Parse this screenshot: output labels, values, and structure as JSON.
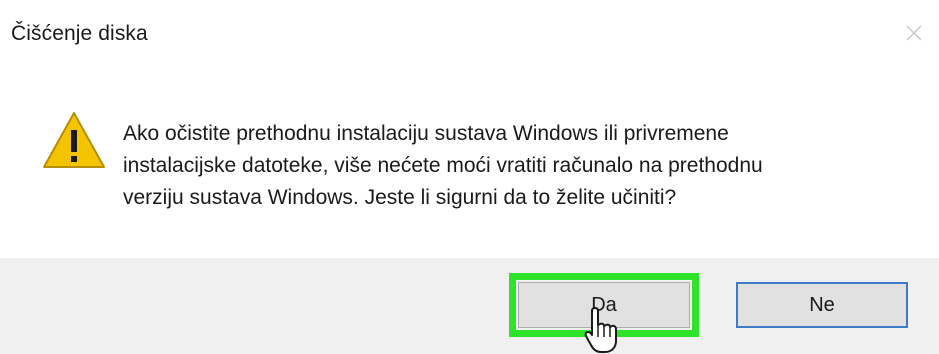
{
  "window": {
    "title": "Čišćenje diska",
    "close_icon": "close-icon"
  },
  "dialog": {
    "icon": "warning-icon",
    "message_lines": [
      "Ako očistite prethodnu instalaciju sustava Windows ili privremene",
      "instalacijske datoteke, više nećete moći vratiti računalo na prethodnu",
      "verziju sustava Windows. Jeste li sigurni da to želite učiniti?"
    ]
  },
  "buttons": {
    "yes_label": "Da",
    "no_label": "Ne"
  },
  "colors": {
    "highlight": "#2ee32a",
    "default_button_border": "#3d7bc9",
    "footer_bg": "#f0f0f0",
    "warning_fill": "#f5c400"
  },
  "pointer": "hand-cursor-icon"
}
